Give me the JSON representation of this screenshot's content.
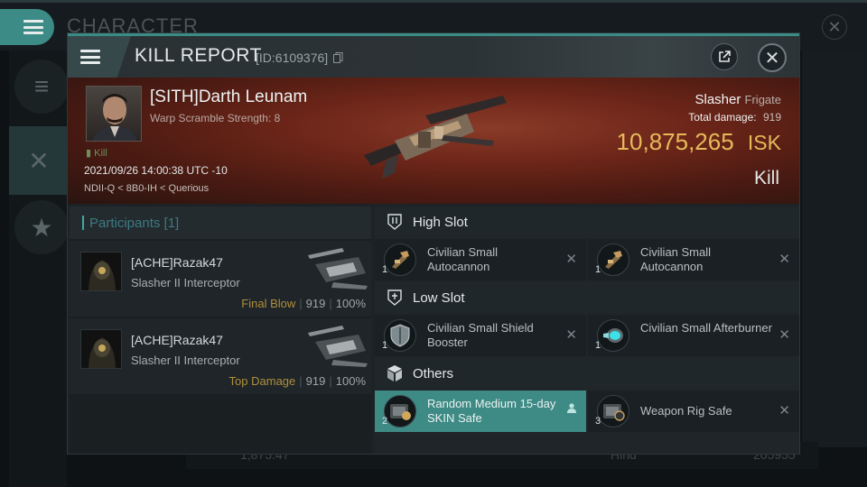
{
  "background": {
    "title": "CHARACTER",
    "bottom_left": "1,875.47",
    "bottom_mid": "Hind",
    "bottom_right": "205955"
  },
  "modal": {
    "title": "KILL REPORT",
    "report_id": "[ID:6109376]",
    "close_glyph": "✕"
  },
  "victim": {
    "name": "[SITH]Darth Leunam",
    "warp_scramble": "Warp Scramble Strength: 8",
    "kill_tag": "Kill",
    "datetime": "2021/09/26 14:00:38 UTC -10",
    "location": "NDII-Q < 8B0-IH < Querious",
    "ship_name": "Slasher",
    "ship_class": "Frigate",
    "total_damage_label": "Total damage:",
    "total_damage": "919",
    "isk_value": "10,875,265",
    "isk_unit": "ISK",
    "result": "Kill"
  },
  "participants": {
    "title": "Participants [1]",
    "rows": [
      {
        "name": "[ACHE]Razak47",
        "ship": "Slasher II Interceptor",
        "role": "Final Blow",
        "damage": "919",
        "percent": "100%"
      },
      {
        "name": "[ACHE]Razak47",
        "ship": "Slasher II Interceptor",
        "role": "Top Damage",
        "damage": "919",
        "percent": "100%"
      }
    ]
  },
  "fitting": {
    "sections": [
      {
        "title": "High Slot",
        "icon": "high-slot-icon",
        "items": [
          {
            "name": "Civilian Small Autocannon",
            "qty": "1",
            "icon": "autocannon-icon"
          },
          {
            "name": "Civilian Small Autocannon",
            "qty": "1",
            "icon": "autocannon-icon"
          }
        ]
      },
      {
        "title": "Low Slot",
        "icon": "low-slot-icon",
        "items": [
          {
            "name": "Civilian Small Shield Booster",
            "qty": "1",
            "icon": "shield-booster-icon"
          },
          {
            "name": "Civilian Small Afterburner",
            "qty": "1",
            "icon": "afterburner-icon"
          }
        ]
      },
      {
        "title": "Others",
        "icon": "cube-icon",
        "items": [
          {
            "name": "Random Medium 15-day SKIN Safe",
            "qty": "2",
            "icon": "skin-safe-icon"
          },
          {
            "name": "Weapon Rig Safe",
            "qty": "3",
            "icon": "rig-safe-icon"
          }
        ]
      }
    ],
    "destroyed_mark": "✕"
  },
  "colors": {
    "accent": "#3e8a85",
    "isk": "#e7b95a",
    "role": "#b0903d"
  }
}
